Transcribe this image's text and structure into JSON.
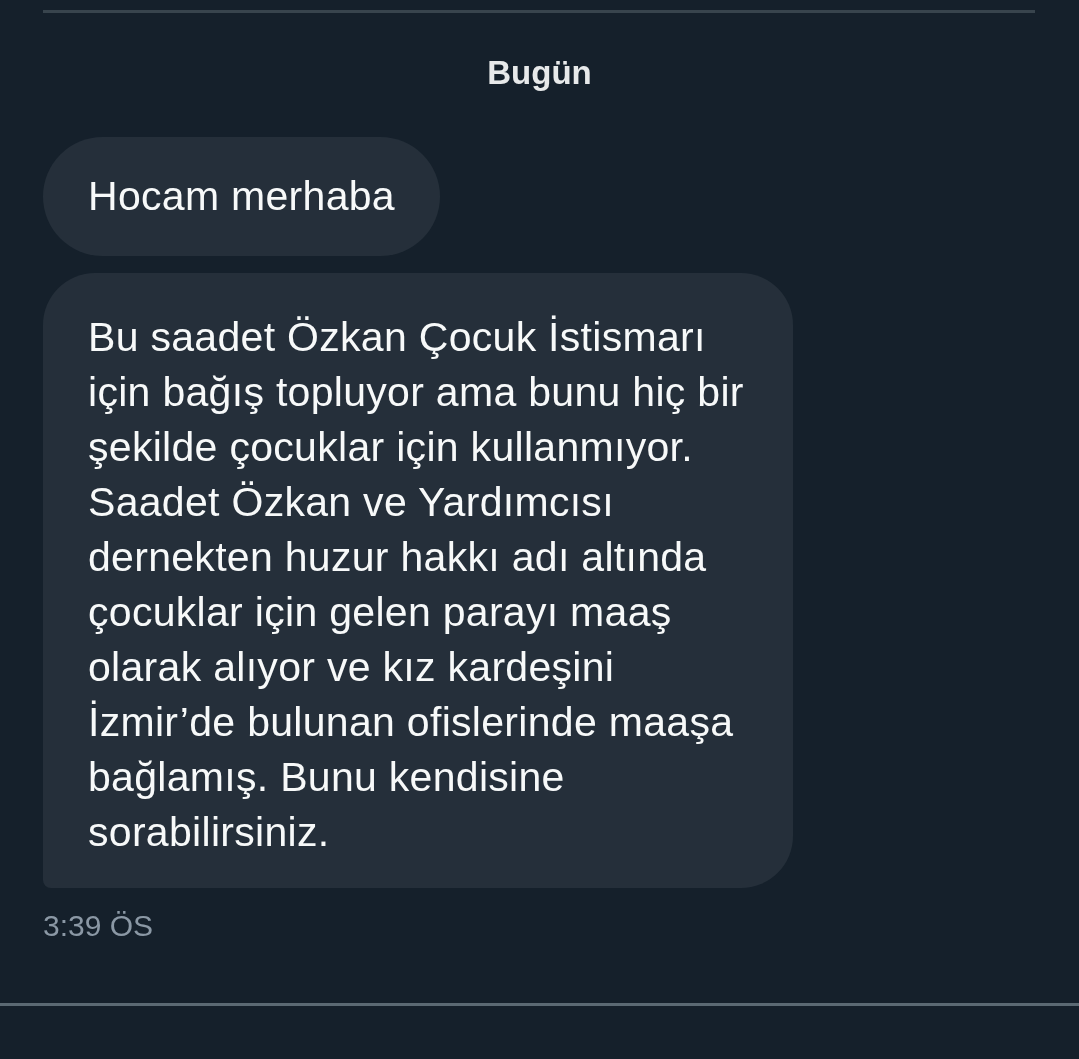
{
  "date_header": "Bugün",
  "messages": [
    {
      "text": "Hocam merhaba"
    },
    {
      "text": "Bu saadet Özkan Çocuk İstismarı için bağış topluyor ama bunu hiç bir şekilde çocuklar için kullanmıyor. Saadet Özkan ve Yardımcısı dernekten huzur hakkı adı altında çocuklar için gelen parayı maaş olarak alıyor ve kız kardeşini İzmir’de bulunan ofislerinde maaşa bağlamış. Bunu kendisine sorabilirsiniz."
    }
  ],
  "timestamp": "3:39 ÖS"
}
